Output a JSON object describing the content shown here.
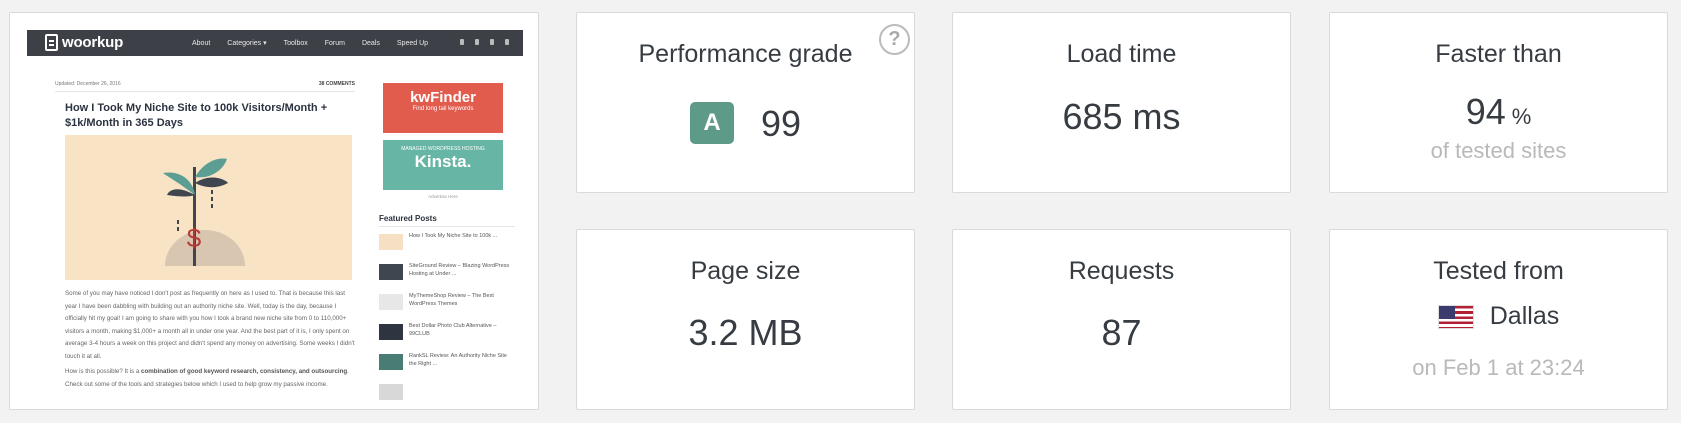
{
  "screenshot": {
    "logo": "woorkup",
    "menu": [
      "About",
      "Categories ▾",
      "Toolbox",
      "Forum",
      "Deals",
      "Speed Up"
    ],
    "updated": "Updated: December 26, 2016",
    "comments": "38 COMMENTS",
    "title": "How I Took My Niche Site to 100k Visitors/Month + $1k/Month in 365 Days",
    "body_p1": "Some of you may have noticed I don't post as frequently on here as I used to. That is because this last year I have been dabbling with building out an authority niche site. Well, today is the day, because I officially hit my goal! I am going to share with you how I took a brand new niche site from 0 to 110,000+ visitors a month, making $1,000+ a month all in under one year. And the best part of it is, I only spent on average 3-4 hours a week on this project and didn't spend any money on advertising. Some weeks I didn't touch it at all.",
    "body_p2_start": "How is this possible? It is a ",
    "body_p2_bold": "combination of good keyword research, consistency, and outsourcing",
    "body_p2_end": ". Check out some of the tools and strategies below which I used to help grow my passive income.",
    "ad1_brand": "kwFinder",
    "ad1_tag": "Find long tail keywords",
    "ad2_small": "MANAGED WORDPRESS HOSTING",
    "ad2_brand": "Kinsta.",
    "advertise": "Advertise Here",
    "featured_heading": "Featured Posts",
    "featured": [
      "How I Took My Niche Site to 100k ...",
      "SiteGround Review – Blazing WordPress Hosting at Under ...",
      "MyThemeShop Review – The Best WordPress Themes",
      "Best Dollar Photo Club Alternative – 99CLUB",
      "RankSL Review: An Authority Niche Site the Right ..."
    ]
  },
  "metrics": {
    "performance": {
      "label": "Performance grade",
      "grade": "A",
      "score": "99",
      "help": "?"
    },
    "load_time": {
      "label": "Load time",
      "value": "685 ms"
    },
    "faster": {
      "label": "Faster than",
      "value": "94",
      "unit": "%",
      "sub": "of tested sites"
    },
    "page_size": {
      "label": "Page size",
      "value": "3.2 MB"
    },
    "requests": {
      "label": "Requests",
      "value": "87"
    },
    "tested_from": {
      "label": "Tested from",
      "city": "Dallas",
      "sub": "on Feb 1 at 23:24"
    }
  },
  "colors": {
    "grade_badge": "#5d9a87",
    "sub_text": "#b9b9b9",
    "nav": "#3d4147",
    "kwfinder": "#e25c4e",
    "kinsta": "#67b5a4"
  }
}
